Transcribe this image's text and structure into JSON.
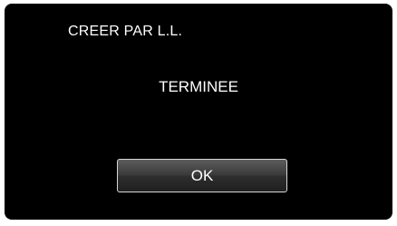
{
  "dialog": {
    "title": "CREER PAR L.L.",
    "message": "TERMINEE",
    "ok_label": "OK"
  }
}
